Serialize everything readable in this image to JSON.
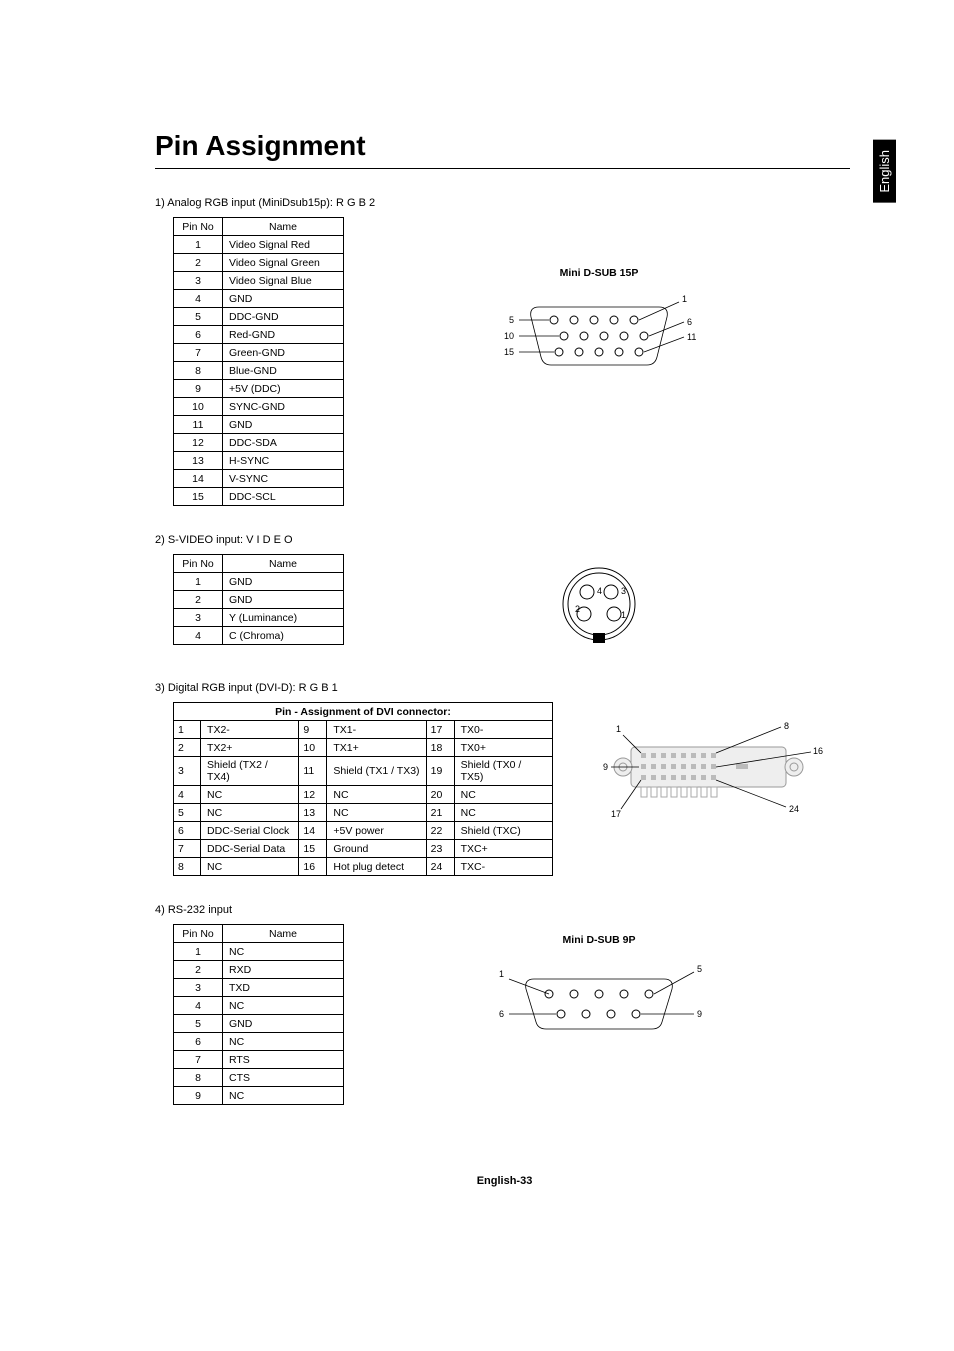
{
  "side_tab": "English",
  "title": "Pin Assignment",
  "sections": {
    "s1": {
      "label": "1)  Analog RGB input (MiniDsub15p): R G B 2",
      "headers": [
        "Pin No",
        "Name"
      ],
      "rows": [
        [
          "1",
          "Video Signal Red"
        ],
        [
          "2",
          "Video Signal Green"
        ],
        [
          "3",
          "Video Signal Blue"
        ],
        [
          "4",
          "GND"
        ],
        [
          "5",
          "DDC-GND"
        ],
        [
          "6",
          "Red-GND"
        ],
        [
          "7",
          "Green-GND"
        ],
        [
          "8",
          "Blue-GND"
        ],
        [
          "9",
          "+5V (DDC)"
        ],
        [
          "10",
          "SYNC-GND"
        ],
        [
          "11",
          "GND"
        ],
        [
          "12",
          "DDC-SDA"
        ],
        [
          "13",
          "H-SYNC"
        ],
        [
          "14",
          "V-SYNC"
        ],
        [
          "15",
          "DDC-SCL"
        ]
      ],
      "diagram_title": "Mini D-SUB 15P",
      "diagram_labels": {
        "l5": "5",
        "l10": "10",
        "l15": "15",
        "l1": "1",
        "l6": "6",
        "l11": "11"
      }
    },
    "s2": {
      "label": "2)  S-VIDEO input: V I D E O",
      "headers": [
        "Pin No",
        "Name"
      ],
      "rows": [
        [
          "1",
          "GND"
        ],
        [
          "2",
          "GND"
        ],
        [
          "3",
          "Y (Luminance)"
        ],
        [
          "4",
          "C (Chroma)"
        ]
      ],
      "diagram_labels": {
        "p1": "1",
        "p2": "2",
        "p3": "3",
        "p4": "4"
      }
    },
    "s3": {
      "label": "3)  Digital RGB input (DVI-D): R G B 1",
      "header": "Pin - Assignment of DVI connector:",
      "rows": [
        [
          "1",
          "TX2-",
          "9",
          "TX1-",
          "17",
          "TX0-"
        ],
        [
          "2",
          "TX2+",
          "10",
          "TX1+",
          "18",
          "TX0+"
        ],
        [
          "3",
          "Shield (TX2 / TX4)",
          "11",
          "Shield (TX1 / TX3)",
          "19",
          "Shield (TX0 / TX5)"
        ],
        [
          "4",
          "NC",
          "12",
          "NC",
          "20",
          "NC"
        ],
        [
          "5",
          "NC",
          "13",
          "NC",
          "21",
          "NC"
        ],
        [
          "6",
          "DDC-Serial Clock",
          "14",
          "+5V power",
          "22",
          "Shield (TXC)"
        ],
        [
          "7",
          "DDC-Serial Data",
          "15",
          "Ground",
          "23",
          "TXC+"
        ],
        [
          "8",
          "NC",
          "16",
          "Hot plug detect",
          "24",
          "TXC-"
        ]
      ],
      "diagram_labels": {
        "l1": "1",
        "l8": "8",
        "l9": "9",
        "l16": "16",
        "l17": "17",
        "l24": "24"
      }
    },
    "s4": {
      "label": "4)  RS-232 input",
      "headers": [
        "Pin No",
        "Name"
      ],
      "rows": [
        [
          "1",
          "NC"
        ],
        [
          "2",
          "RXD"
        ],
        [
          "3",
          "TXD"
        ],
        [
          "4",
          "NC"
        ],
        [
          "5",
          "GND"
        ],
        [
          "6",
          "NC"
        ],
        [
          "7",
          "RTS"
        ],
        [
          "8",
          "CTS"
        ],
        [
          "9",
          "NC"
        ]
      ],
      "diagram_title": "Mini D-SUB 9P",
      "diagram_labels": {
        "l1": "1",
        "l5": "5",
        "l6": "6",
        "l9": "9"
      }
    }
  },
  "footer": "English-33"
}
